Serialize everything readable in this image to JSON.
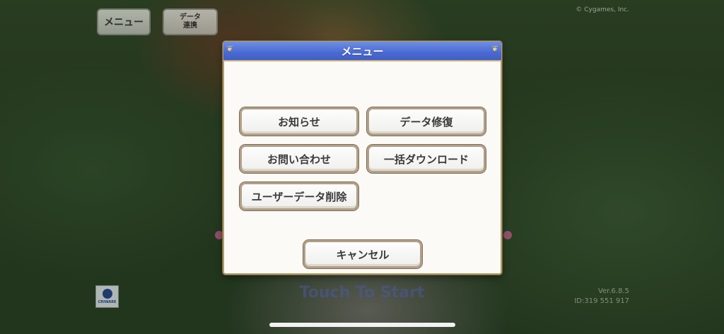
{
  "top_buttons": {
    "menu_label": "メニュー",
    "data_link_line1": "データ",
    "data_link_line2": "連携"
  },
  "copyright": "© Cygames, Inc.",
  "touch_to_start": "Touch To Start",
  "version": {
    "line1": "Ver.6.8.5",
    "line2": "ID:319 551 917"
  },
  "dialog": {
    "title": "メニュー",
    "buttons": {
      "notice": "お知らせ",
      "data_repair": "データ修復",
      "inquiry": "お問い合わせ",
      "bulk_download": "一括ダウンロード",
      "delete_user_data": "ユーザーデータ削除",
      "cancel": "キャンセル"
    }
  },
  "colors": {
    "header_blue": "#4a6ad2",
    "frame_gold": "#b39c64",
    "touch_start": "#4a5aa6"
  }
}
